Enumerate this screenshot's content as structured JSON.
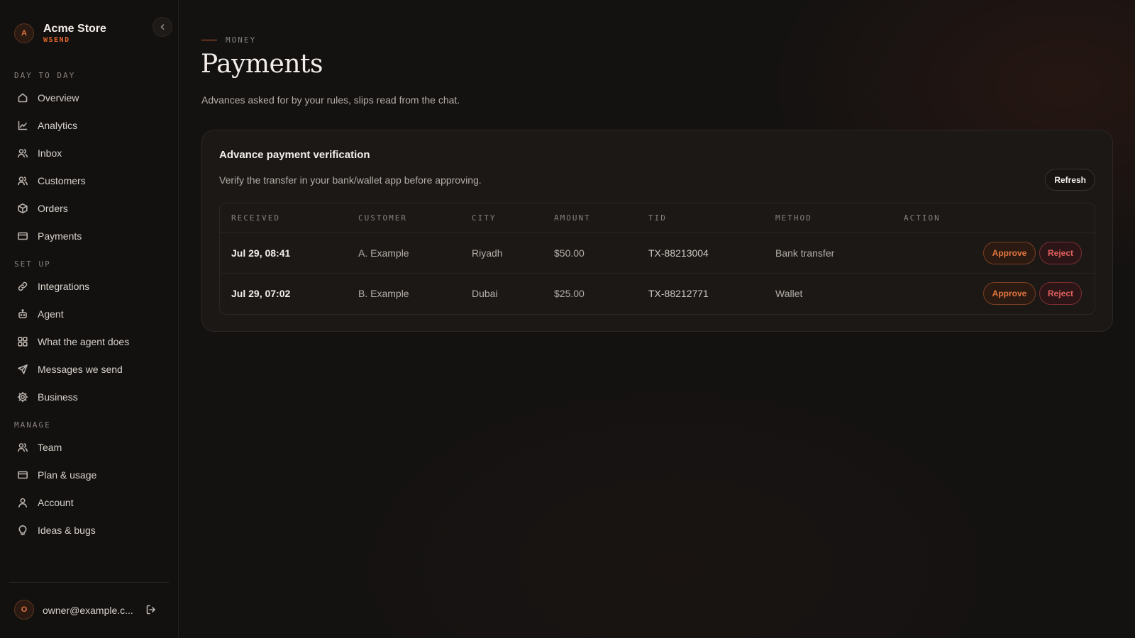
{
  "brand": {
    "avatar_letter": "A",
    "name": "Acme Store",
    "product": "WSEND"
  },
  "sidebar": {
    "sections": [
      {
        "label": "DAY TO DAY",
        "items": [
          {
            "label": "Overview",
            "icon": "home-icon"
          },
          {
            "label": "Analytics",
            "icon": "chart-line-icon"
          },
          {
            "label": "Inbox",
            "icon": "users-icon"
          },
          {
            "label": "Customers",
            "icon": "users-icon"
          },
          {
            "label": "Orders",
            "icon": "box-icon"
          },
          {
            "label": "Payments",
            "icon": "credit-card-icon"
          }
        ]
      },
      {
        "label": "SET UP",
        "items": [
          {
            "label": "Integrations",
            "icon": "link-icon"
          },
          {
            "label": "Agent",
            "icon": "bot-icon"
          },
          {
            "label": "What the agent does",
            "icon": "grid-icon"
          },
          {
            "label": "Messages we send",
            "icon": "send-icon"
          },
          {
            "label": "Business",
            "icon": "gear-icon"
          }
        ]
      },
      {
        "label": "MANAGE",
        "items": [
          {
            "label": "Team",
            "icon": "users-icon"
          },
          {
            "label": "Plan & usage",
            "icon": "credit-card-icon"
          },
          {
            "label": "Account",
            "icon": "user-icon"
          },
          {
            "label": "Ideas & bugs",
            "icon": "lightbulb-icon"
          }
        ]
      }
    ],
    "user": {
      "avatar_letter": "O",
      "email": "owner@example.c..."
    }
  },
  "page": {
    "eyebrow": "MONEY",
    "title": "Payments",
    "subtitle": "Advances asked for by your rules, slips read from the chat."
  },
  "card": {
    "title": "Advance payment verification",
    "description": "Verify the transfer in your bank/wallet app before approving.",
    "refresh_label": "Refresh",
    "columns": [
      "RECEIVED",
      "CUSTOMER",
      "CITY",
      "AMOUNT",
      "TID",
      "METHOD",
      "ACTION"
    ],
    "rows": [
      {
        "received": "Jul 29, 08:41",
        "customer": "A. Example",
        "city": "Riyadh",
        "amount": "$50.00",
        "tid": "TX-88213004",
        "method": "Bank transfer",
        "approve": "Approve",
        "reject": "Reject"
      },
      {
        "received": "Jul 29, 07:02",
        "customer": "B. Example",
        "city": "Dubai",
        "amount": "$25.00",
        "tid": "TX-88212771",
        "method": "Wallet",
        "approve": "Approve",
        "reject": "Reject"
      }
    ]
  },
  "colors": {
    "accent": "#e2652c",
    "reject": "#e0605e",
    "background": "#141211"
  }
}
